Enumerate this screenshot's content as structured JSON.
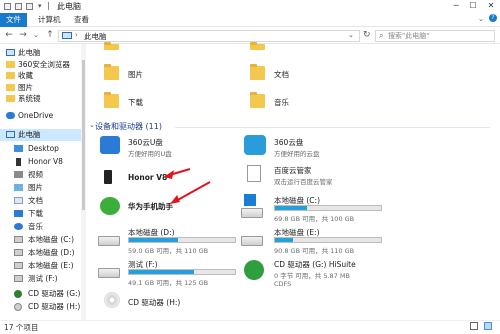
{
  "window": {
    "title": "此电脑"
  },
  "ribbon": {
    "tab_file": "文件",
    "tab_computer": "计算机",
    "tab_view": "查看"
  },
  "address": {
    "path": "此电脑"
  },
  "search": {
    "placeholder": "搜索\"此电脑\""
  },
  "sidebar": {
    "items": [
      {
        "label": "此电脑",
        "icon": "pc-icon"
      },
      {
        "label": "360安全浏览器",
        "icon": "folder-icon"
      },
      {
        "label": "收藏",
        "icon": "folder-icon"
      },
      {
        "label": "图片",
        "icon": "folder-icon"
      },
      {
        "label": "系统镜",
        "icon": "folder-icon"
      },
      {
        "label": "OneDrive",
        "icon": "cloud-icon"
      },
      {
        "label": "此电脑",
        "icon": "pc-icon"
      },
      {
        "label": "Desktop",
        "icon": "desktop-icon"
      },
      {
        "label": "Honor V8",
        "icon": "phone-icon"
      },
      {
        "label": "视频",
        "icon": "video-icon"
      },
      {
        "label": "图片",
        "icon": "image-icon"
      },
      {
        "label": "文档",
        "icon": "document-icon"
      },
      {
        "label": "下载",
        "icon": "download-icon"
      },
      {
        "label": "音乐",
        "icon": "music-icon"
      },
      {
        "label": "本地磁盘 (C:)",
        "icon": "drive-icon"
      },
      {
        "label": "本地磁盘 (D:)",
        "icon": "drive-icon"
      },
      {
        "label": "本地磁盘 (E:)",
        "icon": "drive-icon"
      },
      {
        "label": "测试 (F:)",
        "icon": "drive-icon"
      },
      {
        "label": "CD 驱动器 (G:)",
        "icon": "cd-icon"
      },
      {
        "label": "CD 驱动器 (H:)",
        "icon": "cd-icon"
      }
    ]
  },
  "folders": {
    "pictures": "图片",
    "documents": "文档",
    "downloads": "下载",
    "music": "音乐"
  },
  "devices_section": {
    "title": "设备和驱动器 (11)"
  },
  "devices": {
    "u360": {
      "name": "360云U盘",
      "sub": "方便好用的U盘"
    },
    "cloud360": {
      "name": "360云盘",
      "sub": "方便好用的云盘"
    },
    "honor": {
      "name": "Honor V8"
    },
    "baidu": {
      "name": "百度云管家",
      "sub": "双击运行百度云管家"
    },
    "huawei": {
      "name": "华为手机助手"
    },
    "driveC": {
      "name": "本地磁盘 (C:)",
      "free": "69.8 GB 可用，共 100 GB",
      "used_fraction": 0.302
    },
    "driveD": {
      "name": "本地磁盘 (D:)",
      "free": "59.0 GB 可用，共 110 GB",
      "used_fraction": 0.46
    },
    "driveE": {
      "name": "本地磁盘 (E:)",
      "free": "90.8 GB 可用，共 110 GB",
      "used_fraction": 0.17
    },
    "driveF": {
      "name": "测试 (F:)",
      "free": "49.1 GB 可用，共 125 GB",
      "used_fraction": 0.61
    },
    "cdG": {
      "name": "CD 驱动器 (G:) HiSuite",
      "free": "0 字节 可用，共 5.87 MB",
      "fs": "CDFS"
    },
    "cdH": {
      "name": "CD 驱动器 (H:)"
    }
  },
  "status": {
    "count": "17 个项目"
  },
  "colors": {
    "accent": "#1979ca",
    "bar_fill": "#26a0da",
    "arrow": "#e1141d"
  }
}
